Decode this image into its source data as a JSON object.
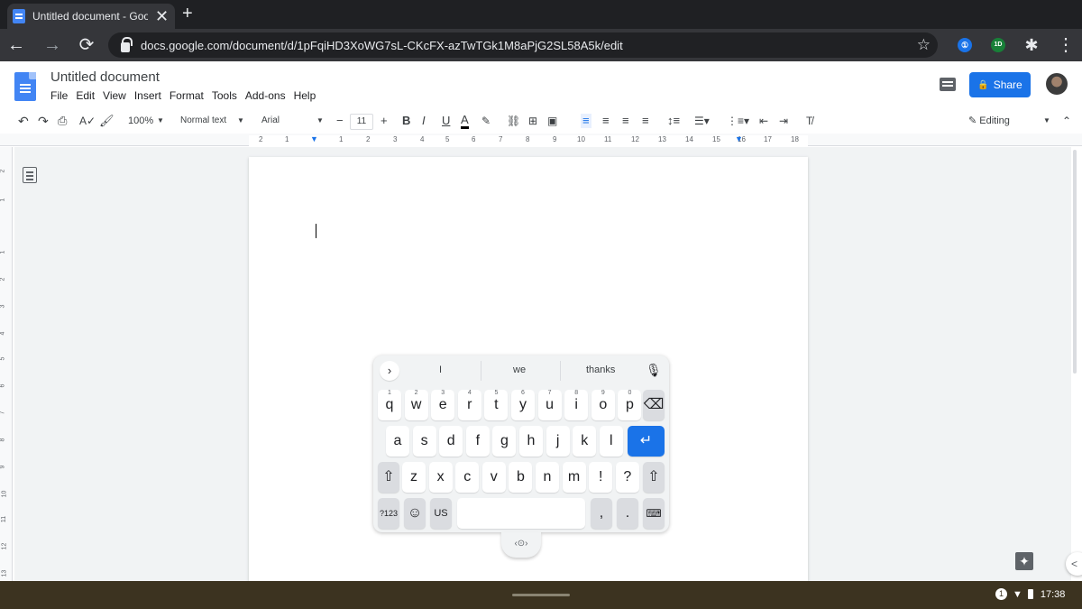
{
  "browser": {
    "tab_title": "Untitled document - Google Do",
    "new_tab": "+",
    "close": "✕",
    "url": "docs.google.com/document/d/1pFqiHD3XoWG7sL-CKcFX-azTwTGk1M8aPjG2SL58A5k/edit",
    "ext_one": "①",
    "ext_two": "1D"
  },
  "doc": {
    "title": "Untitled document",
    "menus": [
      "File",
      "Edit",
      "View",
      "Insert",
      "Format",
      "Tools",
      "Add-ons",
      "Help"
    ],
    "share_label": "Share"
  },
  "toolbar": {
    "zoom": "100%",
    "style": "Normal text",
    "font": "Arial",
    "font_size": "11",
    "bold": "B",
    "italic": "I",
    "underline": "U",
    "text_color": "A",
    "mode": "Editing"
  },
  "ruler": {
    "h": [
      "2",
      "1",
      "1",
      "2",
      "3",
      "4",
      "5",
      "6",
      "7",
      "8",
      "9",
      "10",
      "11",
      "12",
      "13",
      "14",
      "15",
      "16",
      "17",
      "18"
    ],
    "v": [
      "2",
      "1",
      "1",
      "2",
      "3",
      "4",
      "5",
      "6",
      "7",
      "8",
      "9",
      "10",
      "11",
      "12",
      "13"
    ]
  },
  "keyboard": {
    "suggestions": [
      "I",
      "we",
      "thanks"
    ],
    "row1": [
      "q",
      "w",
      "e",
      "r",
      "t",
      "y",
      "u",
      "i",
      "o",
      "p"
    ],
    "row1_hints": [
      "1",
      "2",
      "3",
      "4",
      "5",
      "6",
      "7",
      "8",
      "9",
      "0"
    ],
    "row2": [
      "a",
      "s",
      "d",
      "f",
      "g",
      "h",
      "j",
      "k",
      "l"
    ],
    "row3": [
      "z",
      "x",
      "c",
      "v",
      "b",
      "n",
      "m",
      "!",
      "?"
    ],
    "numbers": "?123",
    "lang": "US",
    "comma": ",",
    "period": "."
  },
  "shelf": {
    "time": "17:38",
    "notif": "1"
  }
}
